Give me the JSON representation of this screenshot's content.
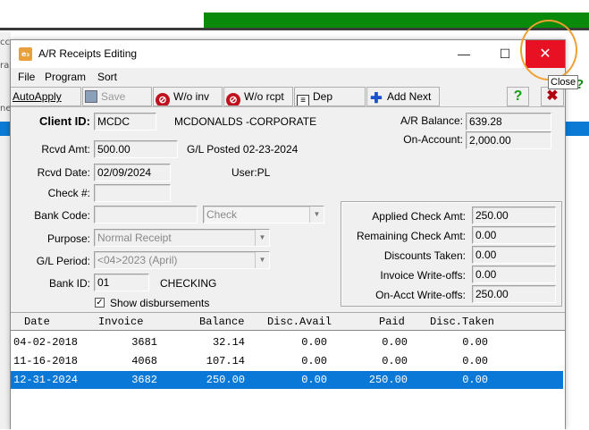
{
  "background": {
    "side_texts": [
      "cc",
      "ra",
      "ne"
    ],
    "right_q": "?"
  },
  "window": {
    "icon_text": "e₃",
    "title": "A/R Receipts Editing",
    "min_glyph": "—",
    "max_glyph": "☐",
    "close_glyph": "✕",
    "close_tooltip": "Close"
  },
  "menu": [
    "File",
    "Program",
    "Sort"
  ],
  "toolbar": {
    "autoapply": "AutoApply",
    "save": "Save",
    "wo_inv": "W/o inv",
    "wo_rcpt": "W/o rcpt",
    "dep": "Dep",
    "add_next": "Add Next",
    "help_glyph": "?",
    "exit_glyph": "✖"
  },
  "client": {
    "label": "Client ID:",
    "id": "MCDC",
    "name": "MCDONALDS -CORPORATE"
  },
  "balances": {
    "ar_label": "A/R Balance:",
    "ar_value": "639.28",
    "onacct_label": "On-Account:",
    "onacct_value": "2,000.00"
  },
  "receipt": {
    "amt_label": "Rcvd Amt:",
    "amt_value": "500.00",
    "gl_posted": "G/L Posted 02-23-2024",
    "date_label": "Rcvd Date:",
    "date_value": "02/09/2024",
    "user": "User:PL",
    "check_label": "Check #:",
    "check_value": "",
    "bankcode_label": "Bank Code:",
    "bankcode_value": "",
    "paytype_value": "Check",
    "purpose_label": "Purpose:",
    "purpose_value": "Normal Receipt",
    "glperiod_label": "G/L Period:",
    "glperiod_value": "<04>2023 (April)",
    "bankid_label": "Bank ID:",
    "bankid_value": "01",
    "bankid_name": "CHECKING",
    "show_disb_label": "Show disbursements",
    "show_disb_checked": "✓"
  },
  "summary": {
    "applied_label": "Applied Check Amt:",
    "applied_value": "250.00",
    "remaining_label": "Remaining Check Amt:",
    "remaining_value": "0.00",
    "discounts_label": "Discounts Taken:",
    "discounts_value": "0.00",
    "inv_wo_label": "Invoice Write-offs:",
    "inv_wo_value": "0.00",
    "onacct_wo_label": "On-Acct Write-offs:",
    "onacct_wo_value": "250.00"
  },
  "grid": {
    "headers": [
      "Date",
      "Invoice",
      "Balance",
      "Disc.Avail",
      "Paid",
      "Disc.Taken"
    ],
    "rows": [
      [
        "04-02-2018",
        "3681",
        "32.14",
        "0.00",
        "0.00",
        "0.00"
      ],
      [
        "11-16-2018",
        "4068",
        "107.14",
        "0.00",
        "0.00",
        "0.00"
      ],
      [
        "12-31-2024",
        "3682",
        "250.00",
        "0.00",
        "250.00",
        "0.00"
      ]
    ]
  },
  "colors": {
    "close_red": "#e81123",
    "selection_blue": "#0a78d7",
    "highlight_orange": "#f0a030"
  }
}
